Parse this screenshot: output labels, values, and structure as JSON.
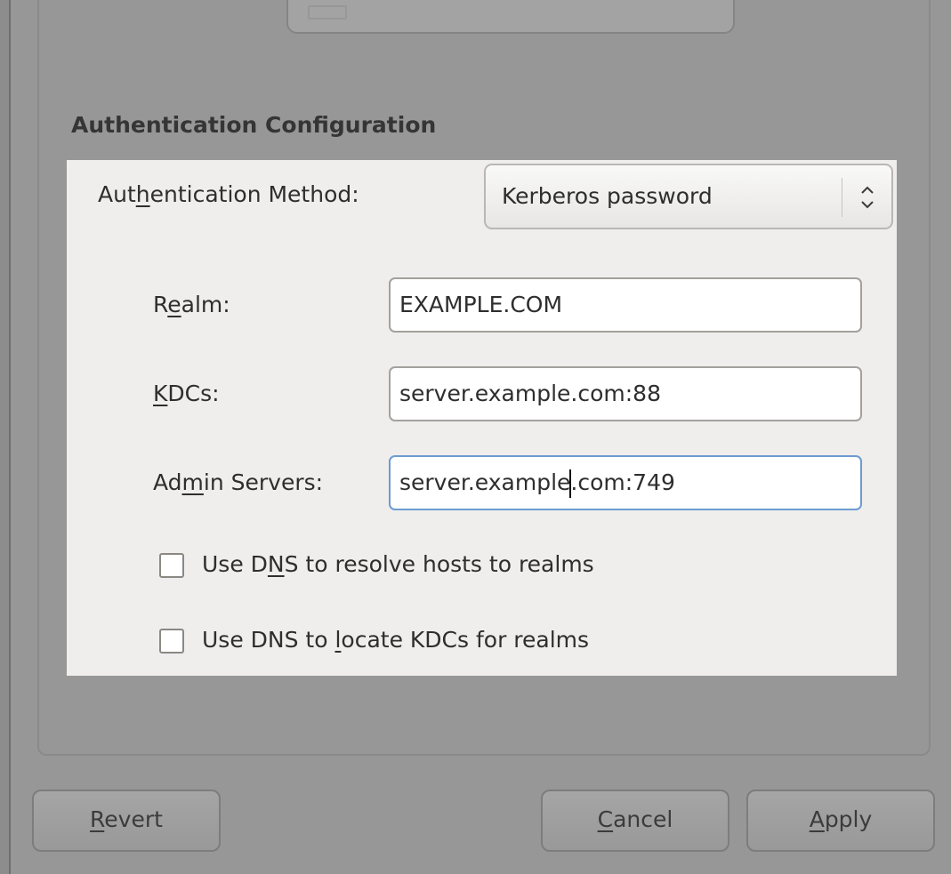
{
  "section": {
    "title": "Authentication Configuration"
  },
  "auth_method": {
    "label_pre": "Aut",
    "label_mnemonic": "h",
    "label_post": "entication Method:",
    "selected": "Kerberos password"
  },
  "realm": {
    "label_pre": "R",
    "label_mnemonic": "e",
    "label_post": "alm:",
    "value": "EXAMPLE.COM"
  },
  "kdcs": {
    "label_pre": "",
    "label_mnemonic": "K",
    "label_post": "DCs:",
    "value": "server.example.com:88"
  },
  "admin_servers": {
    "label_pre": "Ad",
    "label_mnemonic": "m",
    "label_post": "in Servers:",
    "value_before_caret": "server.example",
    "value_after_caret": ".com:749"
  },
  "dns_hosts": {
    "label_pre": "Use D",
    "label_mnemonic": "N",
    "label_post": "S to resolve hosts to realms",
    "checked": false
  },
  "dns_kdcs": {
    "label_pre": "Use DNS to ",
    "label_mnemonic": "l",
    "label_post": "ocate KDCs for realms",
    "checked": false
  },
  "buttons": {
    "revert": {
      "mnemonic": "R",
      "rest": "evert"
    },
    "cancel": {
      "mnemonic": "C",
      "rest": "ancel"
    },
    "apply": {
      "mnemonic": "A",
      "rest": "pply"
    }
  },
  "colors": {
    "panel_bg": "#efeeed",
    "dialog_bg": "#979797",
    "focus_border": "#6d9bd1"
  }
}
